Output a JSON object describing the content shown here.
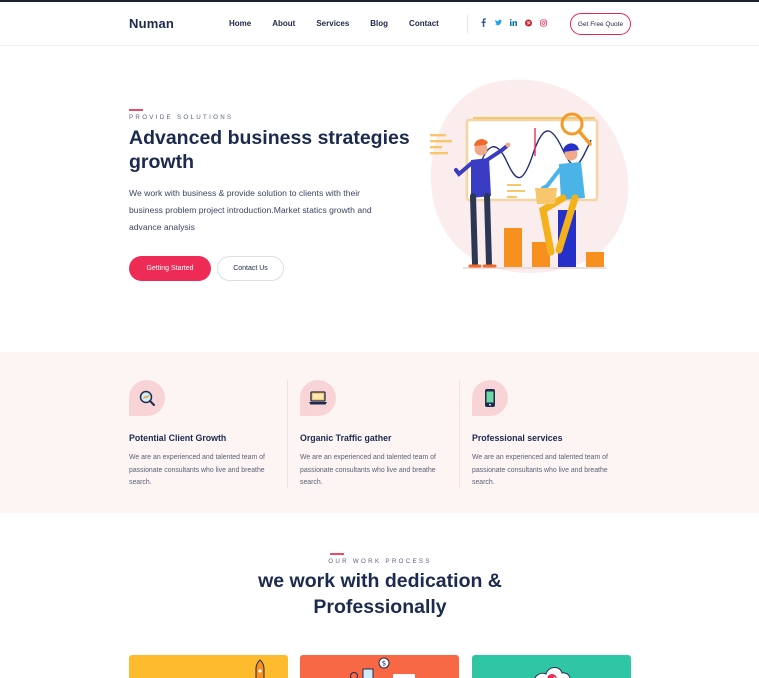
{
  "header": {
    "logo": "Numan",
    "nav": [
      "Home",
      "About",
      "Services",
      "Blog",
      "Contact"
    ],
    "social_icons": [
      "facebook-icon",
      "twitter-icon",
      "linkedin-icon",
      "pinterest-icon",
      "instagram-icon"
    ],
    "cta": "Get Free Quote"
  },
  "hero": {
    "eyebrow": "PROVIDE SOLUTIONS",
    "title_line1": "Advanced business strategies",
    "title_line2": "growth",
    "description_line1": "We work with business & provide solution to clients with their",
    "description_line2": "business problem project introduction.Market statics growth and",
    "description_line3": "advance analysis",
    "primary_button": "Getting Started",
    "secondary_button": "Contact Us"
  },
  "features": [
    {
      "icon": "search-growth-icon",
      "title": "Potential Client Growth",
      "desc_line1": "We are an experienced and talented team of",
      "desc_line2": "passionate consultants who live and breathe",
      "desc_line3": "search."
    },
    {
      "icon": "laptop-icon",
      "title": "Organic Traffic gather",
      "desc_line1": "We are an experienced and talented team of",
      "desc_line2": "passionate consultants who live and breathe",
      "desc_line3": "search."
    },
    {
      "icon": "mobile-phone-icon",
      "title": "Professional services",
      "desc_line1": "We are an experienced and talented team of",
      "desc_line2": "passionate consultants who live and breathe",
      "desc_line3": "search."
    }
  ],
  "process": {
    "eyebrow": "OUR WORK PROCESS",
    "title_line1": "we work with dedication &",
    "title_line2": "Professionally",
    "card_colors": [
      "#fdbb2d",
      "#f86845",
      "#2ec6a4"
    ]
  },
  "colors": {
    "accent": "#ed2b55",
    "navy": "#1b2a4e",
    "band_bg": "#fdf4f4"
  }
}
